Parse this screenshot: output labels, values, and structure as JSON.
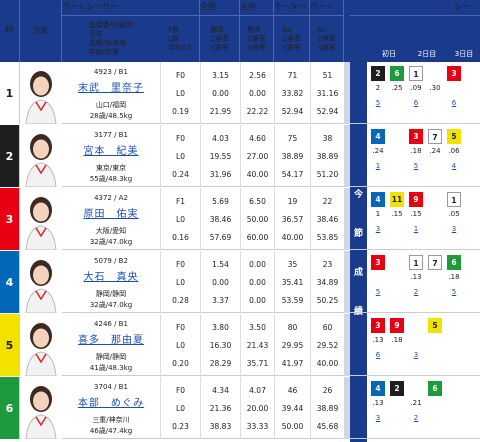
{
  "header": {
    "waku": "枠",
    "photo": "写真",
    "racer": "ボートレーサー",
    "racer_sub": "登録番号/級別\n氏名\n支部/出身地\n年齢/体重",
    "fl": "F数\nL数\n平均ST",
    "national": "全国",
    "national_sub": "勝率\n2連率\n3連率",
    "local": "当地",
    "local_sub": "勝率\n2連率\n3連率",
    "motor": "モーター",
    "motor_sub": "No\n2連率\n3連率",
    "boat": "ボート",
    "boat_sub": "No\n2連率\n3連率",
    "race": "レー",
    "days": [
      "初日",
      "2日目",
      "3日目"
    ]
  },
  "series_label": [
    "今",
    "節",
    "成",
    "績"
  ],
  "colors": {
    "w1": "#ffffff",
    "w2": "#1e1e1e",
    "w3": "#e60012",
    "w4": "#0068b7",
    "w5": "#f3e100",
    "w6": "#1d9a3b"
  },
  "racers": [
    {
      "waku": "1",
      "id": "4923 / B1",
      "name": "末武　里奈子",
      "branch": "山口/福岡",
      "age": "28歳/48.5kg",
      "fl": [
        "F0",
        "L0",
        "0.19"
      ],
      "nat": [
        "3.15",
        "0.00",
        "21.95"
      ],
      "loc": [
        "2.56",
        "0.00",
        "22.22"
      ],
      "mot": [
        "71",
        "33.82",
        "52.94"
      ],
      "bot": [
        "51",
        "31.16",
        "52.94"
      ],
      "rec": [
        [
          "2",
          "6",
          "1",
          "",
          "3"
        ],
        [
          "2",
          ".25",
          ".09",
          ".30",
          ""
        ],
        [
          "5",
          "",
          "6",
          "",
          "6"
        ]
      ]
    },
    {
      "waku": "2",
      "id": "3177 / B1",
      "name": "宮本　紀美",
      "branch": "東京/東京",
      "age": "55歳/48.3kg",
      "fl": [
        "F0",
        "L0",
        "0.24"
      ],
      "nat": [
        "4.03",
        "19.55",
        "31.96"
      ],
      "loc": [
        "4.60",
        "27.00",
        "40.00"
      ],
      "mot": [
        "75",
        "38.89",
        "54.17"
      ],
      "bot": [
        "38",
        "38.89",
        "51.20"
      ],
      "rec": [
        [
          "4",
          "",
          "3",
          "7",
          "5"
        ],
        [
          ".24",
          "",
          ".18",
          ".24",
          ".06"
        ],
        [
          "1",
          "",
          "5",
          "",
          "4"
        ]
      ]
    },
    {
      "waku": "3",
      "id": "4372 / A2",
      "name": "原田　佑実",
      "branch": "大阪/愛知",
      "age": "32歳/47.0kg",
      "fl": [
        "F1",
        "L0",
        "0.16"
      ],
      "nat": [
        "5.69",
        "38.46",
        "57.69"
      ],
      "loc": [
        "6.50",
        "50.00",
        "60.00"
      ],
      "mot": [
        "19",
        "36.57",
        "40.00"
      ],
      "bot": [
        "22",
        "38.46",
        "53.85"
      ],
      "rec": [
        [
          "4",
          "11",
          "9",
          "",
          "1"
        ],
        [
          "1",
          ".15",
          ".15",
          "",
          ".05"
        ],
        [
          "3",
          "",
          "1",
          "",
          "3"
        ]
      ]
    },
    {
      "waku": "4",
      "id": "5079 / B2",
      "name": "大石　真央",
      "branch": "静岡/静岡",
      "age": "32歳/47.0kg",
      "fl": [
        "F0",
        "L0",
        "0.28"
      ],
      "nat": [
        "1.54",
        "0.00",
        "3.37"
      ],
      "loc": [
        "0.00",
        "0.00",
        "0.00"
      ],
      "mot": [
        "35",
        "35.41",
        "53.59"
      ],
      "bot": [
        "23",
        "34.89",
        "50.25"
      ],
      "rec": [
        [
          "3",
          "",
          "1",
          "7",
          "6"
        ],
        [
          "",
          "",
          ".13",
          "",
          ".18"
        ],
        [
          "5",
          "",
          "2",
          "",
          "5"
        ]
      ]
    },
    {
      "waku": "5",
      "id": "4246 / B1",
      "name": "喜多　那由夏",
      "branch": "静岡/静岡",
      "age": "41歳/48.3kg",
      "fl": [
        "F0",
        "L0",
        "0.20"
      ],
      "nat": [
        "3.80",
        "16.30",
        "28.29"
      ],
      "loc": [
        "3.50",
        "21.43",
        "35.71"
      ],
      "mot": [
        "80",
        "29.95",
        "41.97"
      ],
      "bot": [
        "60",
        "29.52",
        "40.00"
      ],
      "rec": [
        [
          "3",
          "9",
          "",
          "5",
          ""
        ],
        [
          ".13",
          ".18",
          "",
          "",
          ""
        ],
        [
          "6",
          "",
          "3",
          "",
          ""
        ]
      ]
    },
    {
      "waku": "6",
      "id": "3704 / B1",
      "name": "本部　めぐみ",
      "branch": "三重/神奈川",
      "age": "46歳/47.4kg",
      "fl": [
        "F0",
        "L0",
        "0.23"
      ],
      "nat": [
        "4.34",
        "21.36",
        "38.83"
      ],
      "loc": [
        "4.07",
        "20.00",
        "33.33"
      ],
      "mot": [
        "46",
        "39.44",
        "50.00"
      ],
      "bot": [
        "26",
        "38.89",
        "45.68"
      ],
      "rec": [
        [
          "4",
          "2",
          "",
          "6",
          ""
        ],
        [
          ".13",
          "",
          ".21",
          "",
          ""
        ],
        [
          "3",
          "",
          "2",
          "",
          ""
        ]
      ]
    }
  ]
}
